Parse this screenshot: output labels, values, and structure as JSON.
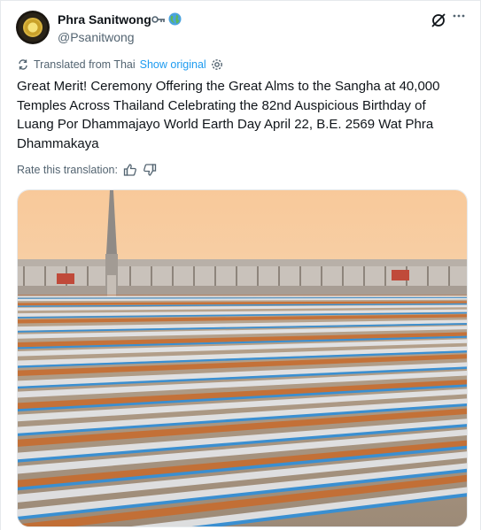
{
  "author": {
    "name": "Phra Sanitwong",
    "handle": "@Psanitwong",
    "badges": [
      "key-emoji",
      "globe-emoji"
    ]
  },
  "translation": {
    "label": "Translated from Thai",
    "show_original": "Show original"
  },
  "tweet": {
    "text": "Great Merit! Ceremony Offering the Great Alms to the Sangha at 40,000 Temples Across Thailand Celebrating the 82nd Auspicious Birthday of Luang Por Dhammajayo World Earth Day April 22, B.E. 2569 Wat Phra Dhammakaya"
  },
  "rating": {
    "label": "Rate this translation:"
  },
  "colors": {
    "link": "#1d9bf0",
    "secondary_text": "#536471",
    "sky_top": "#f6c89a",
    "monk_robes": "#c86a2a",
    "attendee_white": "#e9ecf1",
    "cloth_blue": "#3a8fd1"
  }
}
